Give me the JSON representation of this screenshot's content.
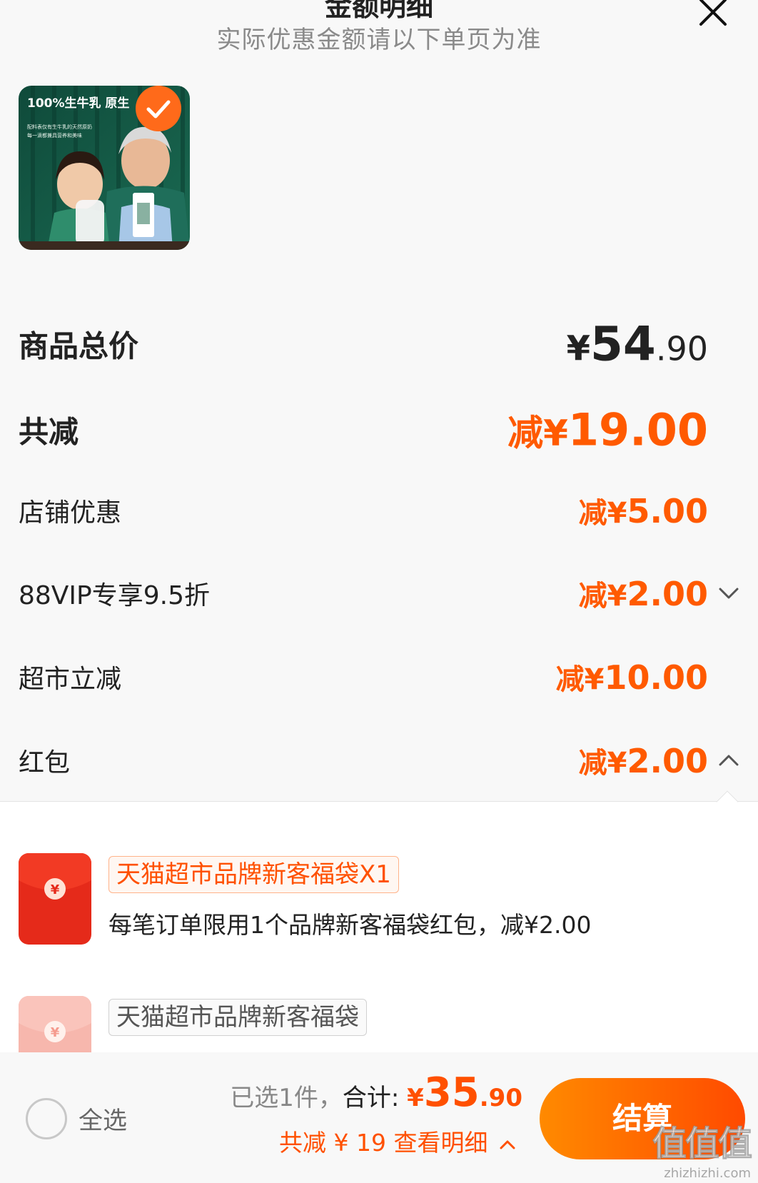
{
  "header": {
    "title": "金额明细",
    "subtitle": "实际优惠金额请以下单页为准"
  },
  "product": {
    "image_text_1": "100%生牛乳 原生",
    "image_text_2": "配料表仅有生牛乳的天然原奶",
    "image_text_3": "每一滴都兼具营养和美味",
    "selected": true
  },
  "rows": [
    {
      "label": "商品总价",
      "prefix": "¥",
      "amount_int": "54",
      "amount_dec": ".90"
    },
    {
      "label": "共减",
      "prefix": "减¥",
      "amount": "19.00"
    },
    {
      "label": "店铺优惠",
      "prefix": "减¥",
      "amount": "5.00"
    },
    {
      "label": "88VIP专享9.5折",
      "prefix": "减¥",
      "amount": "2.00"
    },
    {
      "label": "超市立减",
      "prefix": "减¥",
      "amount": "10.00"
    },
    {
      "label": "红包",
      "prefix": "减¥",
      "amount": "2.00"
    }
  ],
  "coupons": [
    {
      "tag": "天猫超市品牌新客福袋X1",
      "desc": "每笔订单限用1个品牌新客福袋红包，减¥2.00"
    },
    {
      "tag": "天猫超市品牌新客福袋"
    }
  ],
  "bottom_bar": {
    "select_all_label": "全选",
    "selected_count_text": "已选1件，",
    "total_label": "合计:",
    "total_prefix": "¥",
    "total_int": "35",
    "total_dec": ".90",
    "savings_text": "共减 ¥ 19  查看明细",
    "checkout_label": "结算"
  },
  "watermark": {
    "text": "值值值",
    "url": "zhizhizhi.com"
  },
  "colors": {
    "accent": "#ff5a00",
    "checkout_gradient_start": "#ff8a00",
    "checkout_gradient_end": "#ff4a00"
  }
}
